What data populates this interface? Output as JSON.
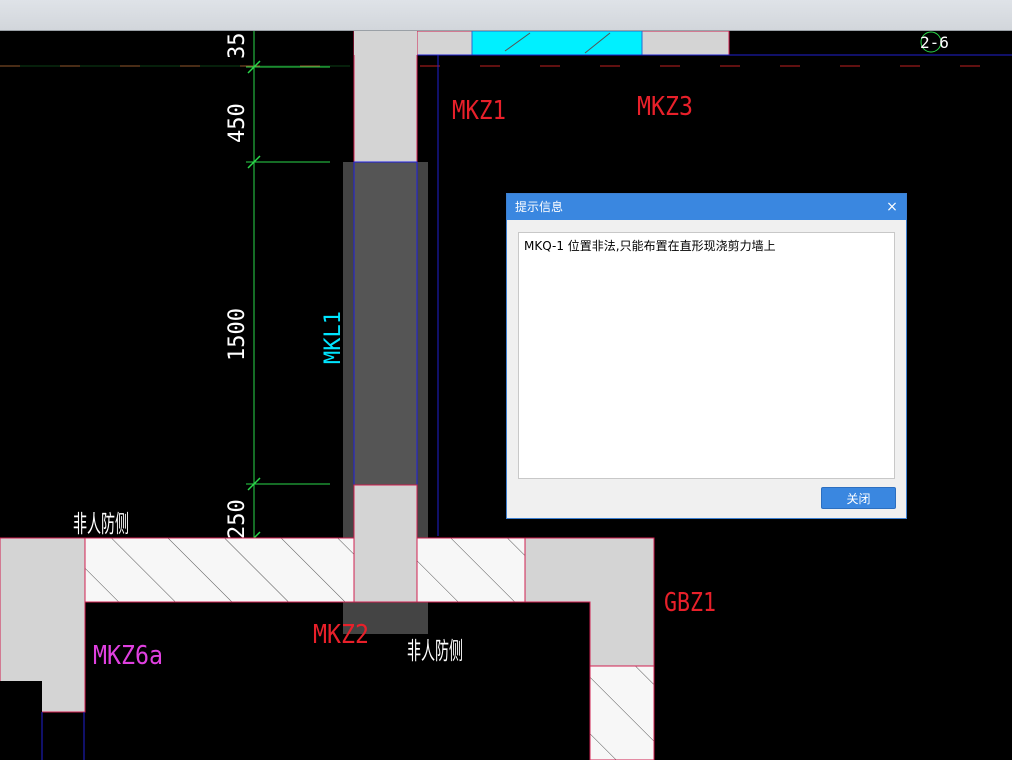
{
  "drawing": {
    "dims": [
      "35",
      "450",
      "1500",
      "250"
    ],
    "labels": {
      "mkz1": "MKZ1",
      "mkz3": "MKZ3",
      "mkl1": "MKL1",
      "mkz2": "MKZ2",
      "mkz6a": "MKZ6a",
      "gbz1": "GBZ1",
      "non_blast_1": "非人防侧",
      "non_blast_2": "非人防侧",
      "axis": "2-6"
    },
    "colors": {
      "red_label": "#e8202a",
      "magenta_label": "#e040e0",
      "cyan": "#00e5ff",
      "dim_green": "#2ad84a",
      "wall_gray": "#d4d4d4",
      "column_dark": "#555555",
      "hatch": "#f7f7f7"
    }
  },
  "dialog": {
    "title": "提示信息",
    "close_icon": "×",
    "message": "MKQ-1 位置非法,只能布置在直形现浇剪力墙上",
    "button": "关闭"
  }
}
